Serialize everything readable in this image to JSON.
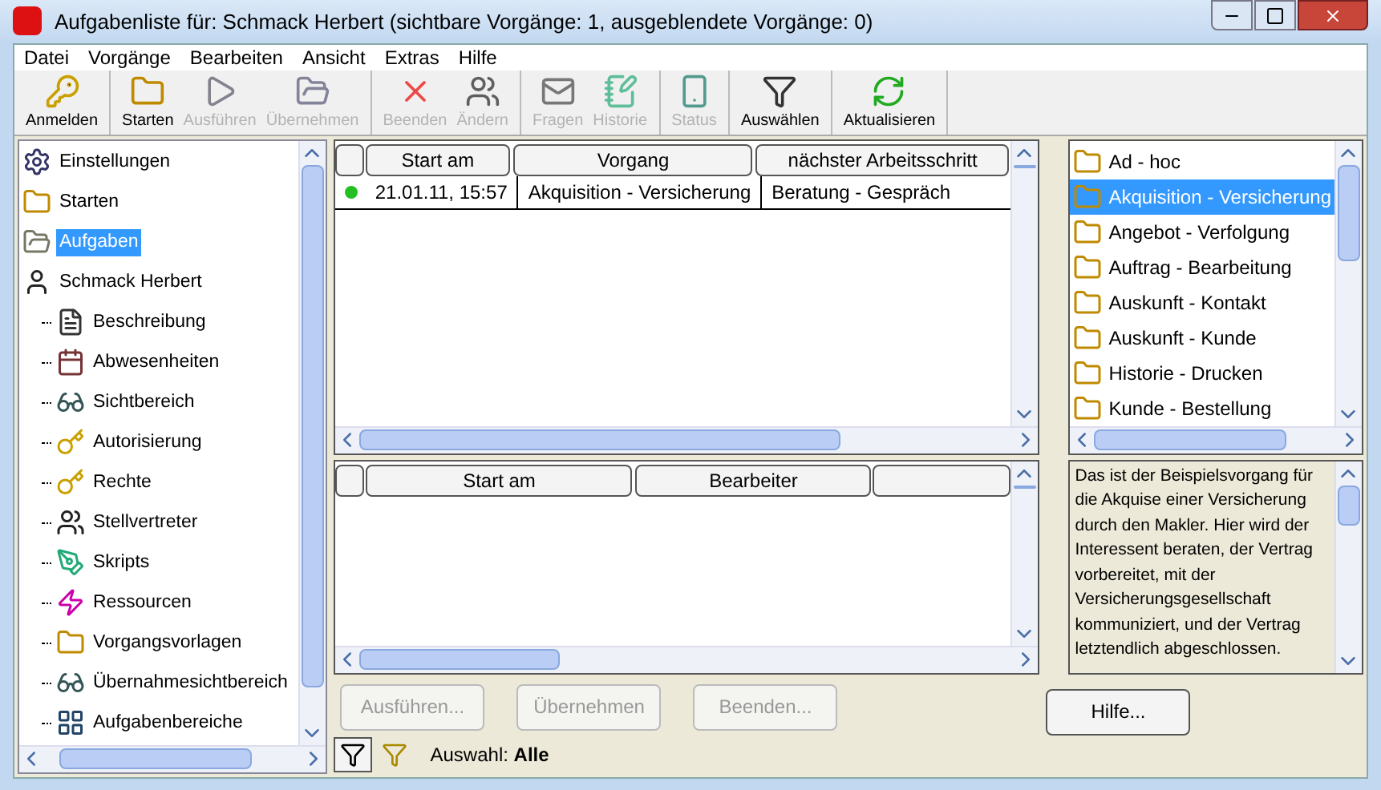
{
  "window": {
    "title": "Aufgabenliste für: Schmack Herbert (sichtbare Vorgänge: 1, ausgeblendete Vorgänge: 0)"
  },
  "menu": [
    "Datei",
    "Vorgänge",
    "Bearbeiten",
    "Ansicht",
    "Extras",
    "Hilfe"
  ],
  "toolbar": [
    {
      "label": "Anmelden",
      "kind": "login",
      "disabled": false
    },
    {
      "label": "Starten",
      "kind": "start",
      "disabled": false
    },
    {
      "label": "Ausführen",
      "kind": "run",
      "disabled": true
    },
    {
      "label": "Übernehmen",
      "kind": "take",
      "disabled": true
    },
    {
      "label": "Beenden",
      "kind": "end",
      "disabled": true
    },
    {
      "label": "Ändern",
      "kind": "change",
      "disabled": true
    },
    {
      "label": "Fragen",
      "kind": "ask",
      "disabled": true
    },
    {
      "label": "Historie",
      "kind": "history",
      "disabled": true
    },
    {
      "label": "Status",
      "kind": "status",
      "disabled": true
    },
    {
      "label": "Auswählen",
      "kind": "select",
      "disabled": false
    },
    {
      "label": "Aktualisieren",
      "kind": "refresh",
      "disabled": false
    }
  ],
  "sidebar": {
    "items": [
      {
        "label": "Einstellungen",
        "kind": "settings",
        "selected": false
      },
      {
        "label": "Starten",
        "kind": "start",
        "selected": false
      },
      {
        "label": "Aufgaben",
        "kind": "tasks",
        "selected": true
      },
      {
        "label": "Schmack Herbert",
        "kind": "person",
        "selected": false,
        "children": [
          {
            "label": "Beschreibung",
            "kind": "doc",
            "selected": false
          },
          {
            "label": "Abwesenheiten",
            "kind": "calendar",
            "selected": false
          },
          {
            "label": "Sichtbereich",
            "kind": "glasses",
            "selected": false
          },
          {
            "label": "Autorisierung",
            "kind": "key",
            "selected": false
          },
          {
            "label": "Rechte",
            "kind": "key",
            "selected": false
          },
          {
            "label": "Stellvertreter",
            "kind": "people",
            "selected": false
          },
          {
            "label": "Skripts",
            "kind": "script",
            "selected": false
          },
          {
            "label": "Ressourcen",
            "kind": "resource",
            "selected": false
          },
          {
            "label": "Vorgangsvorlagen",
            "kind": "start",
            "selected": false
          },
          {
            "label": "Übernahmesichtbereich",
            "kind": "glasses",
            "selected": false
          },
          {
            "label": "Aufgabenbereiche",
            "kind": "area",
            "selected": false
          }
        ]
      }
    ]
  },
  "tasks_table": {
    "columns": [
      "Start am",
      "Vorgang",
      "nächster Arbeitsschritt"
    ],
    "rows": [
      {
        "color": "#22c022",
        "cells": [
          "21.01.11, 15:57",
          "Akquisition - Versicherung",
          "Beratung - Gespräch"
        ]
      }
    ]
  },
  "history_table": {
    "columns": [
      "Start am",
      "Bearbeiter"
    ]
  },
  "buttons": [
    {
      "label": "Ausführen...",
      "disabled": true
    },
    {
      "label": "Übernehmen",
      "disabled": true
    },
    {
      "label": "Beenden...",
      "disabled": true
    }
  ],
  "processes": {
    "items": [
      {
        "label": "Ad - hoc",
        "selected": false
      },
      {
        "label": "Akquisition - Versicherung",
        "selected": true
      },
      {
        "label": "Angebot - Verfolgung",
        "selected": false
      },
      {
        "label": "Auftrag - Bearbeitung",
        "selected": false
      },
      {
        "label": "Auskunft - Kontakt",
        "selected": false
      },
      {
        "label": "Auskunft - Kunde",
        "selected": false
      },
      {
        "label": "Historie - Drucken",
        "selected": false
      },
      {
        "label": "Kunde - Bestellung",
        "selected": false
      }
    ],
    "description": "Das ist der Beispielsvorgang für die Akquise einer Versicherung durch den Makler. Hier wird der Interessent beraten, der Vertrag vorbereitet, mit der Versicherungsgesellschaft kommuniziert, und der Vertrag letztendlich abgeschlossen."
  },
  "help_button": {
    "label": "Hilfe..."
  },
  "status_bar": {
    "text": "Auswahl: **Alle**"
  }
}
